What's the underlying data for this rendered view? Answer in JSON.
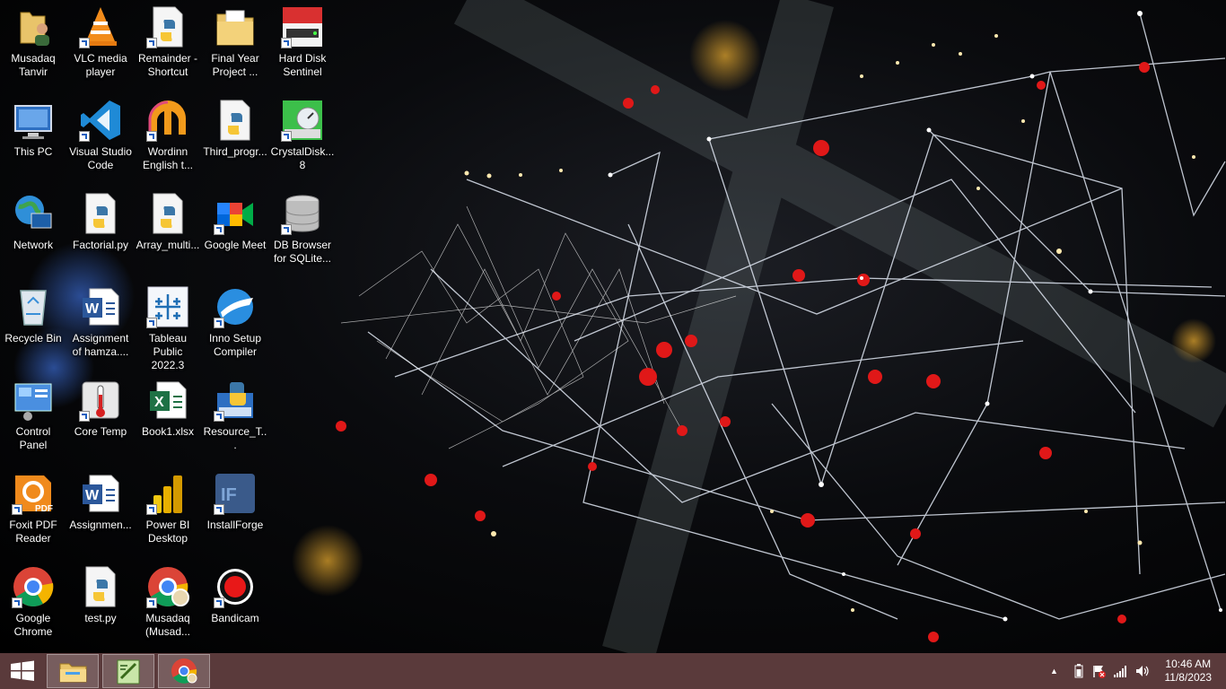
{
  "desktop": {
    "icons": [
      {
        "label": "Musadaq Tanvir",
        "icon": "user-folder-icon"
      },
      {
        "label": "VLC media player",
        "icon": "vlc-icon"
      },
      {
        "label": "Remainder - Shortcut",
        "icon": "python-file-icon"
      },
      {
        "label": "Final Year Project ...",
        "icon": "folder-icon"
      },
      {
        "label": "Hard Disk Sentinel",
        "icon": "hdd-sentinel-icon"
      },
      {
        "label": "This PC",
        "icon": "computer-icon"
      },
      {
        "label": "Visual Studio Code",
        "icon": "vscode-icon"
      },
      {
        "label": "Wordinn English t...",
        "icon": "wordinn-icon"
      },
      {
        "label": "Third_progr...",
        "icon": "python-file-icon"
      },
      {
        "label": "CrystalDisk... 8",
        "icon": "crystaldisk-icon"
      },
      {
        "label": "Network",
        "icon": "network-icon"
      },
      {
        "label": "Factorial.py",
        "icon": "python-file-icon"
      },
      {
        "label": "Array_multi...",
        "icon": "python-file-icon"
      },
      {
        "label": "Google Meet",
        "icon": "google-meet-icon"
      },
      {
        "label": "DB Browser for SQLite...",
        "icon": "database-icon"
      },
      {
        "label": "Recycle Bin",
        "icon": "recycle-bin-icon"
      },
      {
        "label": "Assignment of hamza....",
        "icon": "word-doc-icon"
      },
      {
        "label": "Tableau Public 2022.3",
        "icon": "tableau-icon"
      },
      {
        "label": "Inno Setup Compiler",
        "icon": "inno-setup-icon"
      },
      {
        "label": "Control Panel",
        "icon": "control-panel-icon"
      },
      {
        "label": "Core Temp",
        "icon": "thermometer-icon"
      },
      {
        "label": "Book1.xlsx",
        "icon": "excel-icon"
      },
      {
        "label": "Resource_T...",
        "icon": "python-folder-icon"
      },
      {
        "label": "Foxit PDF Reader",
        "icon": "foxit-pdf-icon"
      },
      {
        "label": "Assignmen...",
        "icon": "word-doc-icon"
      },
      {
        "label": "Power BI Desktop",
        "icon": "powerbi-icon"
      },
      {
        "label": "InstallForge",
        "icon": "installforge-icon"
      },
      {
        "label": "Google Chrome",
        "icon": "chrome-icon"
      },
      {
        "label": "test.py",
        "icon": "python-file-icon"
      },
      {
        "label": "Musadaq (Musad...",
        "icon": "chrome-profile-icon"
      },
      {
        "label": "Bandicam",
        "icon": "bandicam-icon"
      }
    ]
  },
  "taskbar": {
    "time": "10:46 AM",
    "date": "11/8/2023",
    "pinned": [
      "file-explorer-icon",
      "notepad-plus-icon",
      "chrome-icon"
    ],
    "tray_arrow": "▲"
  },
  "colors": {
    "taskbar": "#5a3a3b"
  }
}
